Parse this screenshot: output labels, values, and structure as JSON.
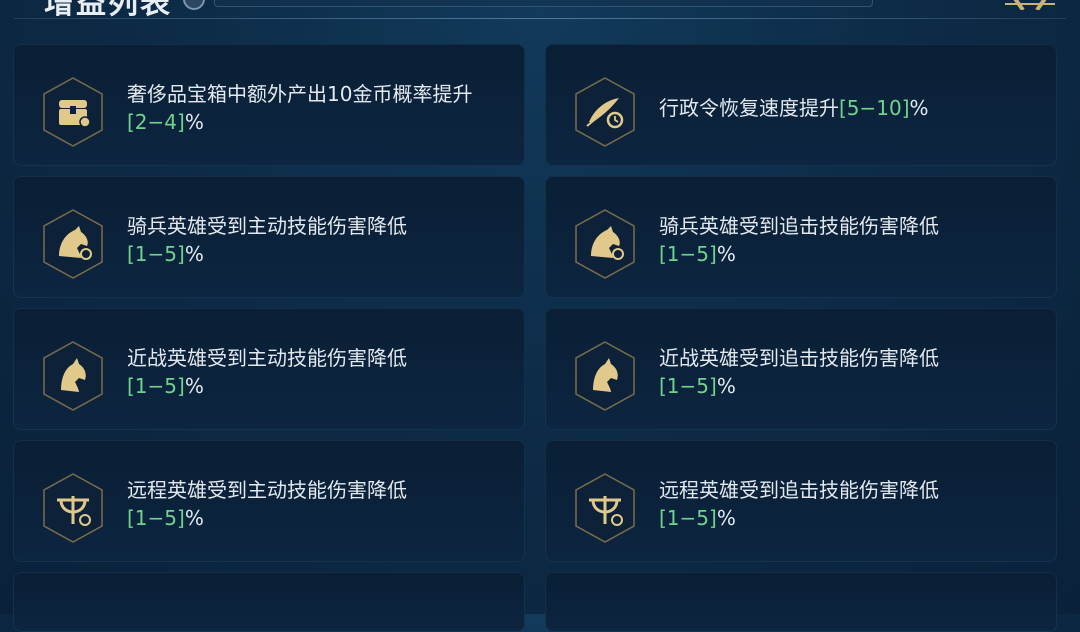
{
  "header": {
    "title": "增益列表"
  },
  "items": [
    {
      "icon": "treasure-chest-icon",
      "text": "奢侈品宝箱中额外产出10金币概率提升",
      "value": "[2−4]",
      "unit": "%"
    },
    {
      "icon": "quill-clock-icon",
      "text": "行政令恢复速度提升",
      "value": "[5−10]",
      "unit": "%"
    },
    {
      "icon": "cavalry-horse-icon",
      "text": "骑兵英雄受到主动技能伤害降低",
      "value": "[1−5]",
      "unit": "%"
    },
    {
      "icon": "cavalry-horse-icon",
      "text": "骑兵英雄受到追击技能伤害降低",
      "value": "[1−5]",
      "unit": "%"
    },
    {
      "icon": "melee-horse-icon",
      "text": "近战英雄受到主动技能伤害降低",
      "value": "[1−5]",
      "unit": "%"
    },
    {
      "icon": "melee-horse-icon",
      "text": "近战英雄受到追击技能伤害降低",
      "value": "[1−5]",
      "unit": "%"
    },
    {
      "icon": "crossbow-icon",
      "text": "远程英雄受到主动技能伤害降低",
      "value": "[1−5]",
      "unit": "%"
    },
    {
      "icon": "crossbow-icon",
      "text": "远程英雄受到追击技能伤害降低",
      "value": "[1−5]",
      "unit": "%"
    }
  ],
  "colors": {
    "value_green": "#6fd38a",
    "icon_gold": "#d9c48a",
    "card_bg": "#0b2239",
    "page_bg": "#0d2c48"
  }
}
